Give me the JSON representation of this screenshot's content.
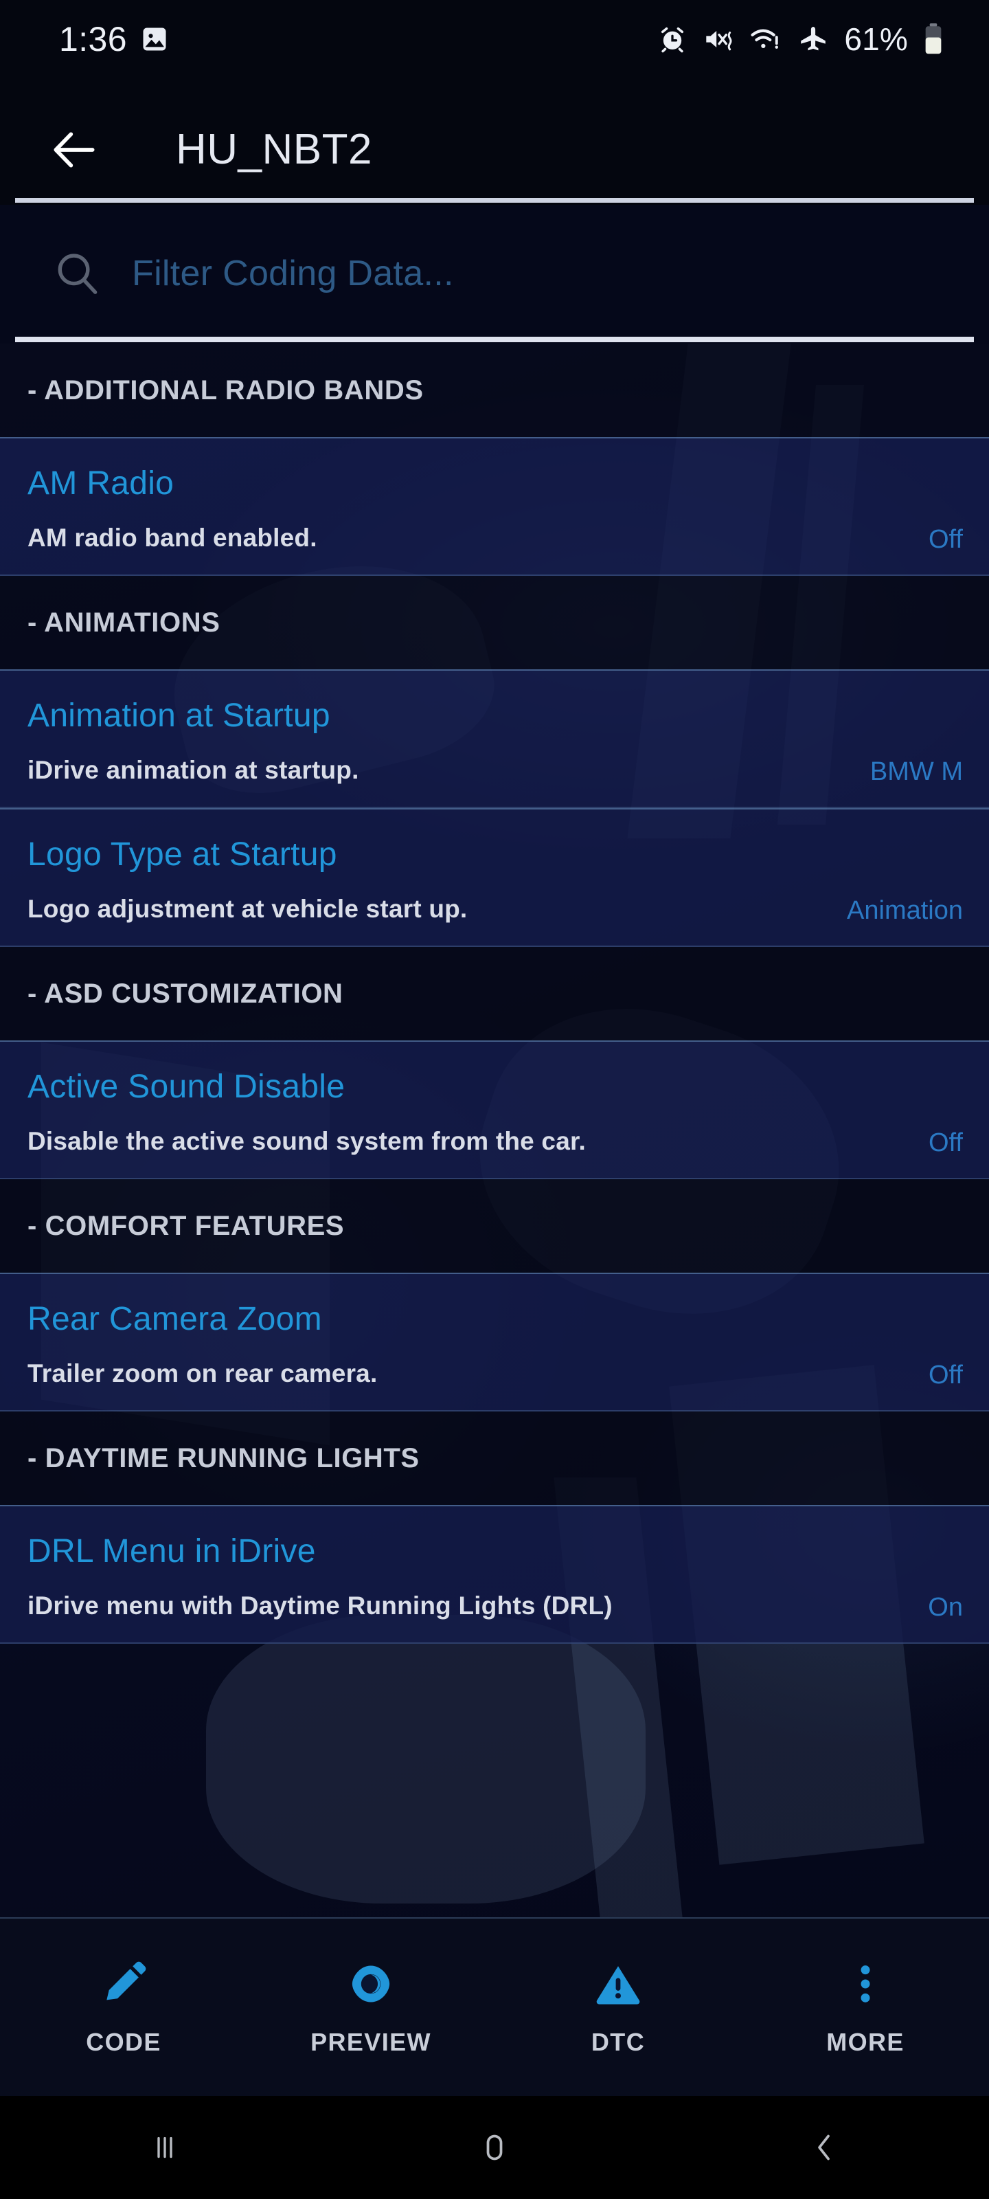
{
  "status_bar": {
    "time": "1:36",
    "battery_percent": "61%",
    "icons": [
      "screenshot-icon",
      "alarm-icon",
      "mute-vibrate-icon",
      "wifi-alert-icon",
      "airplane-mode-icon",
      "battery-icon"
    ]
  },
  "app_bar": {
    "back_label": "back-arrow-icon",
    "title": "HU_NBT2"
  },
  "search": {
    "placeholder": "Filter Coding Data...",
    "value": "",
    "icon": "search-icon"
  },
  "list": [
    {
      "type": "section",
      "label": "- ADDITIONAL RADIO BANDS"
    },
    {
      "type": "item",
      "title": "AM Radio",
      "description": "AM radio band enabled.",
      "value": "Off"
    },
    {
      "type": "section",
      "label": "- ANIMATIONS"
    },
    {
      "type": "item",
      "title": "Animation at Startup",
      "description": "iDrive animation at startup.",
      "value": "BMW M"
    },
    {
      "type": "item",
      "title": "Logo Type at Startup",
      "description": "Logo adjustment at vehicle start up.",
      "value": "Animation"
    },
    {
      "type": "section",
      "label": "- ASD CUSTOMIZATION"
    },
    {
      "type": "item",
      "title": "Active Sound Disable",
      "description": "Disable the active sound system from the car.",
      "value": "Off"
    },
    {
      "type": "section",
      "label": "- COMFORT FEATURES"
    },
    {
      "type": "item",
      "title": "Rear Camera Zoom",
      "description": "Trailer zoom on rear camera.",
      "value": "Off"
    },
    {
      "type": "section",
      "label": "- DAYTIME RUNNING LIGHTS"
    },
    {
      "type": "item",
      "title": "DRL Menu in iDrive",
      "description": "iDrive menu with Daytime Running Lights (DRL)",
      "value": "On"
    }
  ],
  "tabs": [
    {
      "label": "CODE",
      "icon": "pencil-icon"
    },
    {
      "label": "PREVIEW",
      "icon": "eye-icon"
    },
    {
      "label": "DTC",
      "icon": "warning-triangle-icon"
    },
    {
      "label": "MORE",
      "icon": "overflow-dots-icon"
    }
  ],
  "system_nav": [
    {
      "name": "recents-icon"
    },
    {
      "name": "home-icon"
    },
    {
      "name": "back-icon"
    }
  ],
  "colors": {
    "accent": "#2196d9",
    "value_text": "#2b79c4",
    "section_text": "#c7ccd8",
    "row_bg": "#141b4b",
    "page_bg": "#04060f"
  }
}
